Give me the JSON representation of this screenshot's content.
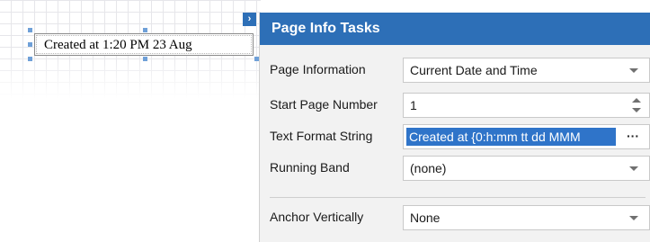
{
  "designer": {
    "control_text": "Created at 1:20 PM 23  Aug",
    "smart_tag_glyph": "›"
  },
  "panel": {
    "title": "Page Info Tasks",
    "rows": [
      {
        "label": "Page Information",
        "value": "Current Date and Time",
        "kind": "dropdown"
      },
      {
        "label": "Start Page Number",
        "value": "1",
        "kind": "spinner"
      },
      {
        "label": "Text Format String",
        "value": "Created at {0:h:mm tt dd MMM",
        "kind": "text-editor",
        "button": "···"
      },
      {
        "label": "Running Band",
        "value": "(none)",
        "kind": "dropdown"
      },
      {
        "label": "Anchor Vertically",
        "value": "None",
        "kind": "dropdown"
      }
    ]
  },
  "colors": {
    "header": "#2d6fb7",
    "selection": "#2f74c9",
    "panel_bg": "#f2f2f2"
  }
}
